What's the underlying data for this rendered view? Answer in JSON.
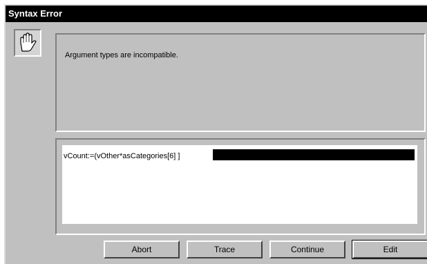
{
  "dialog": {
    "title": "Syntax Error",
    "icon": "stop-hand-icon",
    "message": "Argument types are incompatible.",
    "source_line": "vCount:=(vOther*asCategories[6] ]",
    "buttons": {
      "abort": "Abort",
      "trace": "Trace",
      "continue": "Continue",
      "edit": "Edit"
    }
  },
  "colors": {
    "titlebar": "#000000",
    "face": "#c0c0c0",
    "highlight": "#000000"
  }
}
